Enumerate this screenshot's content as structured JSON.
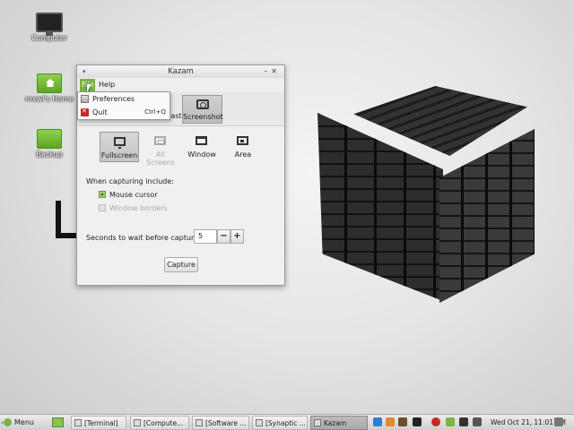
{
  "desktop": {
    "icons": [
      {
        "label": "Computer",
        "icon": "monitor-icon"
      },
      {
        "label": "mxwi's Home",
        "icon": "home-folder-icon"
      },
      {
        "label": "Backup",
        "icon": "folder-icon"
      }
    ]
  },
  "window": {
    "title": "Kazam",
    "menu": {
      "file": "File",
      "help": "Help"
    },
    "modes": {
      "screencast": "Screencast",
      "screenshot": "Screenshot"
    },
    "areas": [
      {
        "label": "Fullscreen",
        "state": "active"
      },
      {
        "label": "All Screens",
        "state": "disabled"
      },
      {
        "label": "Window",
        "state": "normal"
      },
      {
        "label": "Area",
        "state": "normal"
      }
    ],
    "capturing_label": "When capturing include:",
    "mouse_cursor": {
      "label": "Mouse cursor",
      "checked": true
    },
    "window_borders": {
      "label": "Window borders",
      "checked": false
    },
    "delay_label": "Seconds to wait before capturing:",
    "delay_value": "5",
    "minus": "−",
    "plus": "+",
    "capture_button": "Capture"
  },
  "file_menu": {
    "preferences": "Preferences",
    "quit": "Quit",
    "quit_shortcut": "Ctrl+Q"
  },
  "taskbar": {
    "menu_label": "Menu",
    "tasks": [
      "[Terminal]",
      "[Compute...",
      "[Software ...",
      "[Synaptic ...",
      "Kazam"
    ],
    "active_task": "Kazam",
    "clock": "Wed Oct 21, 11:01 AM",
    "colors": {
      "accent": "#7cb342"
    }
  }
}
